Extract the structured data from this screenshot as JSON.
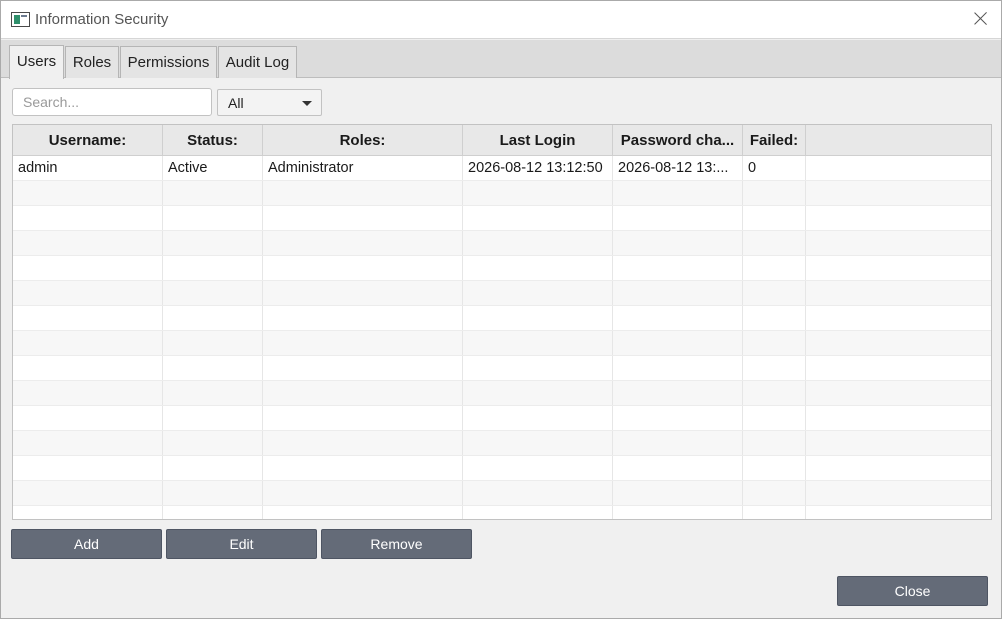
{
  "window": {
    "title": "Information Security"
  },
  "tabs": [
    {
      "label": "Users",
      "active": true
    },
    {
      "label": "Roles",
      "active": false
    },
    {
      "label": "Permissions",
      "active": false
    },
    {
      "label": "Audit Log",
      "active": false
    }
  ],
  "search": {
    "placeholder": "Search...",
    "value": ""
  },
  "filter": {
    "selected": "All"
  },
  "table": {
    "columns": [
      "Username:",
      "Status:",
      "Roles:",
      "Last Login",
      "Password cha...",
      "Failed:",
      ""
    ],
    "rows": [
      [
        "admin",
        "Active",
        "Administrator",
        "2026-08-12 13:12:50",
        "2026-08-12 13:...",
        "0",
        ""
      ]
    ]
  },
  "actions": {
    "add": "Add",
    "edit": "Edit",
    "remove": "Remove"
  },
  "footer": {
    "close": "Close"
  },
  "colors": {
    "button_bg": "#646b78",
    "header_bg": "#e8e8e8",
    "tabstrip_bg": "#dcdcdc"
  },
  "icons": {
    "app": "app-window-icon",
    "close": "close-icon",
    "dropdown": "chevron-down-icon"
  }
}
